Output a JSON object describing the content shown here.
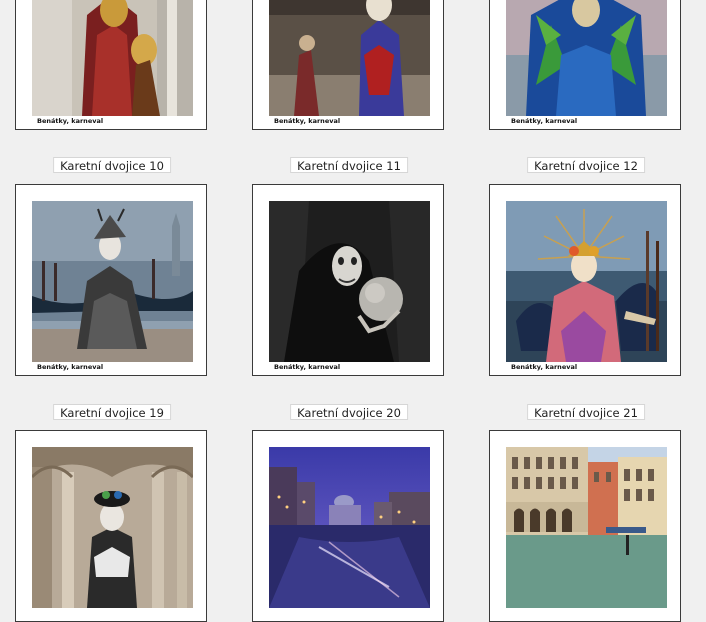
{
  "cards": [
    {
      "caption": "Benátky, karneval"
    },
    {
      "caption": "Benátky, karneval"
    },
    {
      "caption": "Benátky, karneval"
    },
    {
      "title": "Karetní dvojice 10",
      "caption": "Benátky, karneval"
    },
    {
      "title": "Karetní dvojice 11",
      "caption": "Benátky, karneval"
    },
    {
      "title": "Karetní dvojice 12",
      "caption": "Benátky, karneval"
    },
    {
      "title": "Karetní dvojice 19"
    },
    {
      "title": "Karetní dvojice 20"
    },
    {
      "title": "Karetní dvojice 21"
    }
  ]
}
